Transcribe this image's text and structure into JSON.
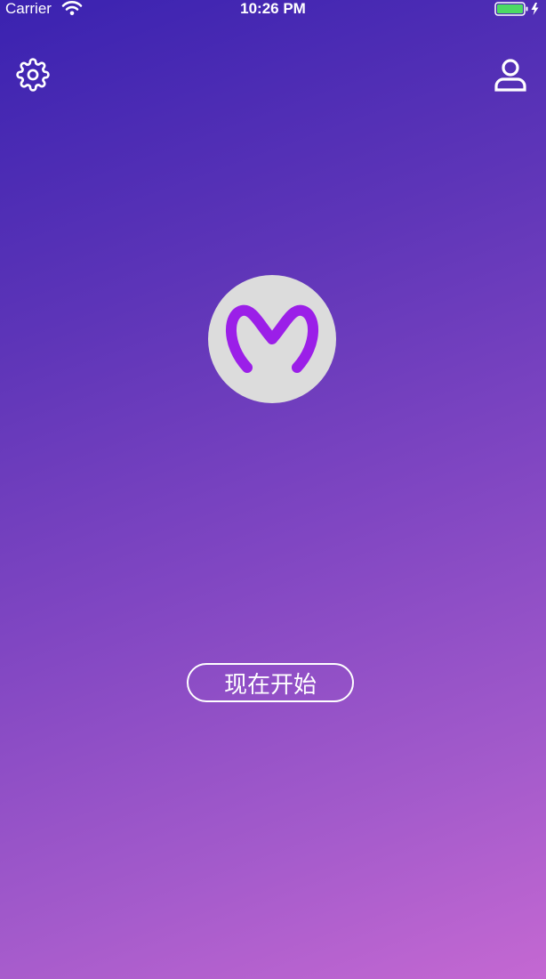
{
  "status_bar": {
    "carrier": "Carrier",
    "time": "10:26 PM",
    "icons": [
      "wifi-icon",
      "battery-icon",
      "charging-bolt-icon"
    ]
  },
  "header": {
    "left_icon": "gear-icon",
    "right_icon": "user-icon"
  },
  "logo": {
    "letter_icon": "m-logo-icon",
    "color": "#9b1fe8"
  },
  "main": {
    "start_label": "现在开始"
  },
  "colors": {
    "gradient_start": "#3a22b0",
    "gradient_end": "#c468d2",
    "battery_fill": "#4cd964"
  }
}
